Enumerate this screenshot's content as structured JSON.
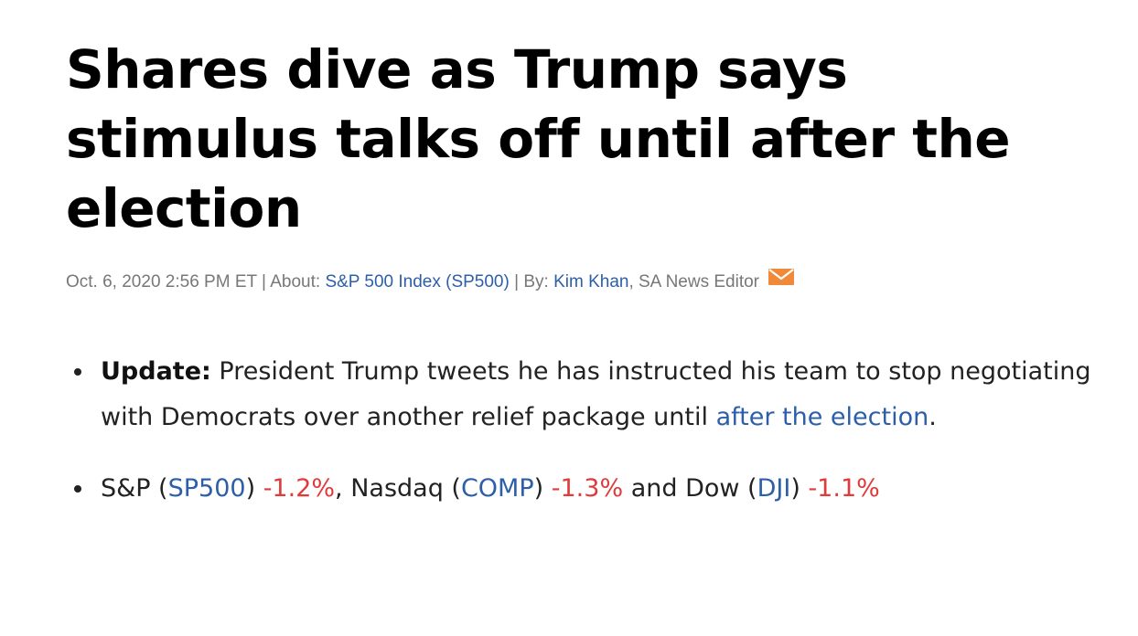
{
  "article": {
    "title": "Shares dive as Trump says stimulus talks off until after the election",
    "meta": {
      "datetime": "Oct. 6, 2020 2:56 PM ET",
      "separator": " | ",
      "about_label": "About: ",
      "about_link": "S&P 500 Index (SP500)",
      "by_label": "By: ",
      "author_link": "Kim Khan",
      "author_role": ", SA News Editor",
      "email_icon": "envelope-icon",
      "email_icon_color": "#f0893a"
    },
    "bullets": {
      "update": {
        "label": "Update:",
        "text": " President Trump tweets he has instructed his team to stop negotiating with Democrats over another relief package until ",
        "link": "after the election",
        "end": "."
      },
      "markets": {
        "sp_label": "S&P (",
        "sp_ticker": "SP500",
        "sp_close": ") ",
        "sp_change": "-1.2%",
        "nasdaq_label": ", Nasdaq (",
        "nasdaq_ticker": "COMP",
        "nasdaq_close": ") ",
        "nasdaq_change": "-1.3%",
        "dow_label": " and Dow (",
        "dow_ticker": "DJI",
        "dow_close": ") ",
        "dow_change": "-1.1%"
      }
    }
  },
  "colors": {
    "link": "#2c5fa8",
    "negative": "#e03a3a",
    "meta_text": "#777777"
  }
}
